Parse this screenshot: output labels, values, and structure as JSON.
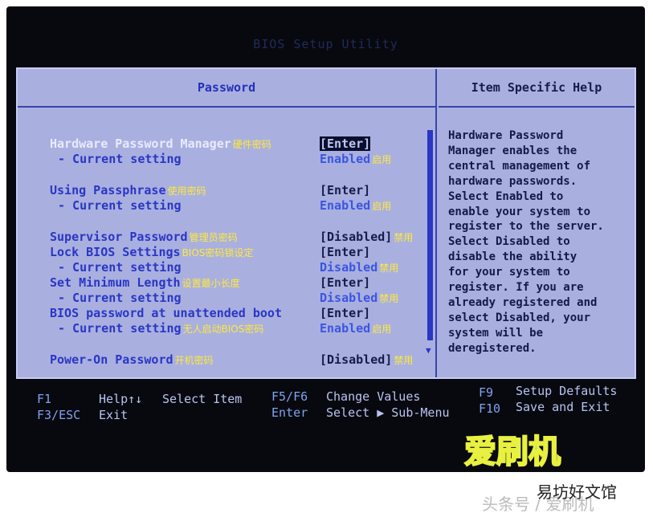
{
  "title": "BIOS Setup Utility",
  "panel_title": "Password",
  "help_title": "Item Specific Help",
  "help_text": "Hardware Password\nManager enables the\ncentral management of\nhardware passwords.\nSelect Enabled to\nenable your system to\nregister to the server.\nSelect Disabled to\ndisable the ability\nfor your system to\nregister. If you are\nalready registered and\nselect Disabled, your\nsystem will be\nderegistered.",
  "items": [
    {
      "label": "Hardware Password Manager",
      "cn": "硬件密码",
      "value": "[Enter]",
      "selected": true
    },
    {
      "label": "- Current setting",
      "cn": "",
      "value": "Enabled",
      "value_cn": "启用"
    },
    {
      "label": "Using Passphrase",
      "cn": "使用密码",
      "value": "[Enter]"
    },
    {
      "label": "- Current setting",
      "cn": "",
      "value": "Enabled",
      "value_cn": "启用"
    },
    {
      "label": "Supervisor Password",
      "cn": "管理员密码",
      "value": "[Disabled]",
      "value_cn": "禁用"
    },
    {
      "label": "Lock BIOS Settings",
      "cn": "BIOS密码锁设定",
      "value": "[Enter]"
    },
    {
      "label": "- Current setting",
      "cn": "",
      "value": "Disabled",
      "value_cn": "禁用"
    },
    {
      "label": "Set Minimum Length",
      "cn": "设置最小长度",
      "value": "[Enter]"
    },
    {
      "label": "- Current setting",
      "cn": "",
      "value": "Disabled",
      "value_cn": "禁用"
    },
    {
      "label": "BIOS password at unattended boot",
      "cn": "",
      "value": "[Enter]"
    },
    {
      "label": "- Current setting",
      "cn": "无人启动BIOS密码",
      "value": "Enabled",
      "value_cn": "启用"
    },
    {
      "label": "Power-On Password",
      "cn": "开机密码",
      "value": "[Disabled]",
      "value_cn": "禁用"
    }
  ],
  "footer": {
    "f1": "F1",
    "help": "Help↑↓",
    "select_item": "Select Item",
    "f3": "F3/ESC",
    "exit": "Exit",
    "f5": "F5/F6",
    "change": "Change Values",
    "enter": "Enter",
    "submenu": "Select ▶ Sub-Menu",
    "f9": "F9",
    "defaults": "Setup Defaults",
    "f10": "F10",
    "save": "Save and Exit"
  },
  "watermark": {
    "logo": "爱刷机",
    "site": "易坊好文馆",
    "source": "头条号 / 爱刷机"
  }
}
